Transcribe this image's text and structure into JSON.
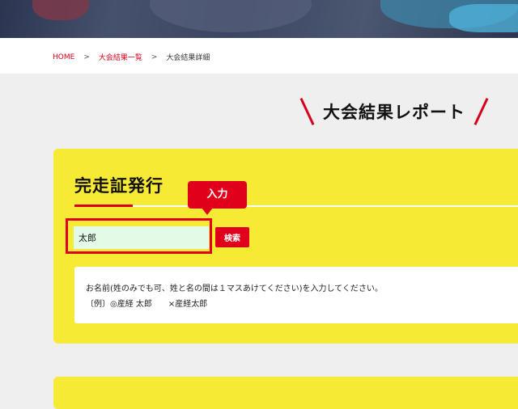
{
  "breadcrumb": {
    "home": "HOME",
    "list": "大会結果一覧",
    "current": "大会結果詳細",
    "separator": ">"
  },
  "page": {
    "title": "大会結果レポート"
  },
  "certificate": {
    "heading": "完走証発行",
    "tooltip": "入力",
    "name_value": "太郎",
    "search_label": "検索",
    "note_line1": "お名前(姓のみでも可、姓と名の間は１マスあけてください)を入力してください。",
    "note_line2": "〔例〕◎産経 太郎　　×産経太郎"
  },
  "colors": {
    "accent": "#e0001b",
    "card_bg": "#f7ea35",
    "input_bg": "#e3fbe6"
  }
}
